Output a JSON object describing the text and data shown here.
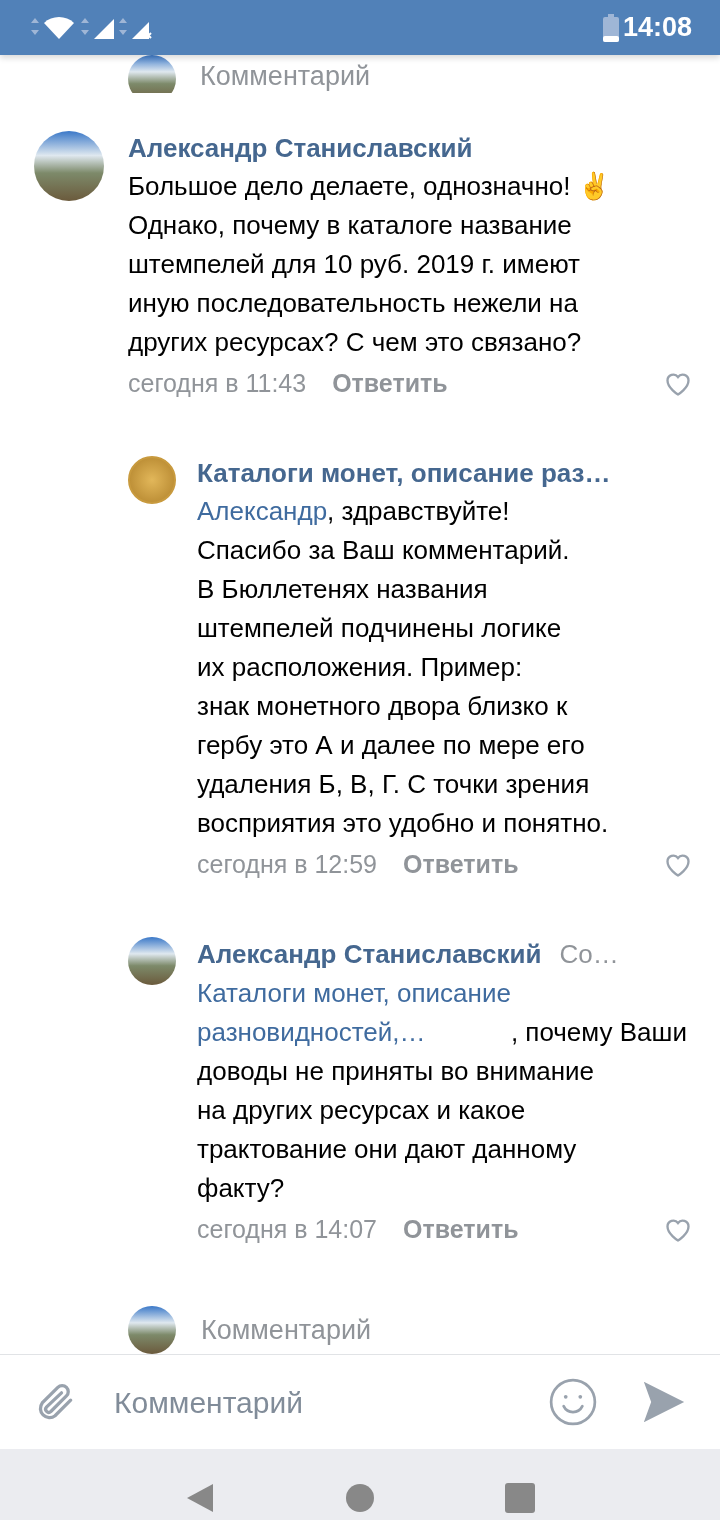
{
  "status_bar": {
    "time": "14:08"
  },
  "top_reply_field": {
    "placeholder": "Комментарий"
  },
  "comments": [
    {
      "kind": "comment",
      "author": "Александр Станиславский",
      "text": "Большое дело делаете, однозначно! ✌️\nОднако, почему в каталоге название\nштемпелей для 10 руб. 2019 г. имеют\nиную последовательность нежели на\nдругих ресурсах? С чем это связано?",
      "time": "сегодня в 11:43",
      "reply": "Ответить",
      "avatar": {
        "kind": "photo"
      }
    },
    {
      "kind": "reply",
      "author": "Каталоги монет, описание раз…",
      "mention": "Александр",
      "text": ", здравствуйте!\nСпасибо за Ваш комментарий.\nВ Бюллетенях названия\nштемпелей подчинены логике\nих расположения. Пример:\nзнак монетного двора близко к\nгербу это А и далее по мере его\nудаления Б, В, Г. С точки зрения\nвосприятия это удобно и понятно.",
      "time": "сегодня в 12:59",
      "reply": "Ответить",
      "avatar": {
        "kind": "coin"
      }
    },
    {
      "kind": "reply",
      "author": "Александр Станиславский",
      "author_suffix": "Со…",
      "mention": "Каталоги монет, описание\nразновидностей,…",
      "text": ", почему Ваши\nдоводы не приняты во внимание\nна других ресурсах и какое\nтрактование они дают данному\nфакту?",
      "time": "сегодня в 14:07",
      "reply": "Ответить",
      "avatar": {
        "kind": "photo"
      }
    }
  ],
  "reply_field": {
    "placeholder": "Комментарий"
  },
  "input_bar": {
    "placeholder": "Комментарий"
  }
}
